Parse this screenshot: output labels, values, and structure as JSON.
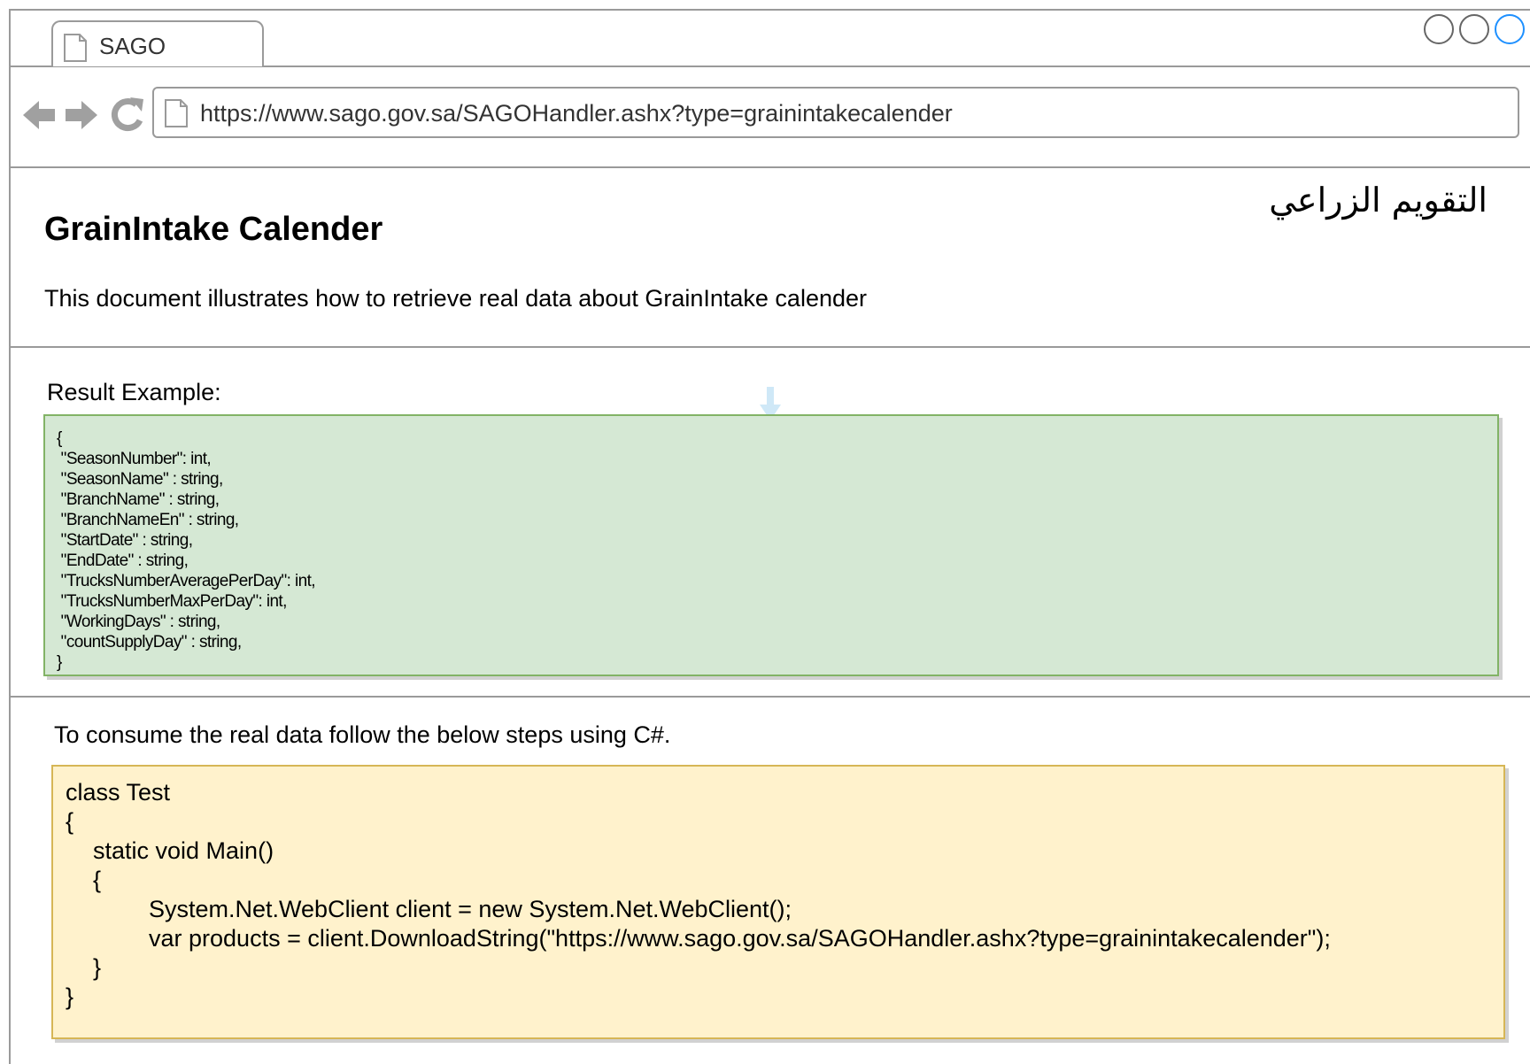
{
  "browser": {
    "tab_title": "SAGO",
    "url": "https://www.sago.gov.sa/SAGOHandler.ashx?type=grainintakecalender",
    "nav_icons": [
      "back-arrow-icon",
      "forward-arrow-icon",
      "reload-icon"
    ],
    "window_controls": [
      "window-control-1",
      "window-control-2",
      "window-control-3"
    ]
  },
  "header": {
    "title": "GrainIntake Calender",
    "arabic_title": "التقويم الزراعي",
    "description": "This document illustrates how to retrieve real data about GrainIntake calender"
  },
  "result": {
    "label": "Result Example:",
    "json_lines": [
      "{",
      " \"SeasonNumber\": int,",
      " \"SeasonName\" : string,",
      " \"BranchName\" : string,",
      " \"BranchNameEn\" : string,",
      " \"StartDate\" : string,",
      " \"EndDate\" : string,",
      " \"TrucksNumberAveragePerDay\": int,",
      " \"TrucksNumberMaxPerDay\": int,",
      " \"WorkingDays\" : string,",
      " \"countSupplyDay\" : string,",
      "}"
    ]
  },
  "consume": {
    "label": "To consume the real data follow the below steps using C#.",
    "code_lines": [
      "class Test",
      "{",
      "static void Main()",
      "{",
      "System.Net.WebClient client = new System.Net.WebClient();",
      "var products = client.DownloadString(\"https://www.sago.gov.sa/SAGOHandler.ashx?type=grainintakecalender\");",
      "}",
      "}"
    ]
  },
  "colors": {
    "json_box_bg": "#d5e8d4",
    "json_box_border": "#82b366",
    "code_box_bg": "#fff2cc",
    "code_box_border": "#d6b656",
    "active_window_control": "#1e90ff"
  }
}
